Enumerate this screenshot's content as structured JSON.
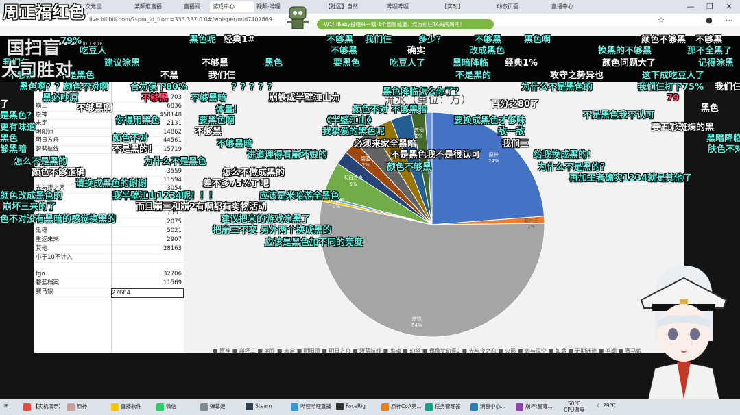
{
  "browser": {
    "tabs": [
      "次元世",
      "某频道直播",
      "直播间",
      "游戏中心",
      "视频-哔哩",
      "【社区】自然",
      "哔哩哔哩",
      "【实时】",
      "动态页面",
      "直播中心"
    ],
    "url": "live.bilibili.com/?spm_id_from=333.337.0.0#/whisper/mid7407869",
    "promo": "-W1川Baby投喂林一瓢-1个圆脑城堡，点击前往TA的房间吧！"
  },
  "stream_info": {
    "bitrate": "4869.22kB",
    "time": "00:13:18"
  },
  "overlay_title": {
    "line1": "周正福红色",
    "line2": "国扫盲",
    "line3": "大司胜对"
  },
  "spreadsheet": {
    "rows": [
      {
        "name": "崩三",
        "value": "6836"
      },
      {
        "name": "原神",
        "value": "458148"
      },
      {
        "name": "未定",
        "value": "2131"
      },
      {
        "name": "阴阳师",
        "value": "14862"
      },
      {
        "name": "明日方舟",
        "value": "44561"
      },
      {
        "name": "碧蓝航线",
        "value": "15719"
      },
      {
        "name": "",
        "value": "3559"
      },
      {
        "name": "",
        "value": "11594"
      },
      {
        "name": "光与夜之恋",
        "value": "3054"
      },
      {
        "name": "",
        "value": "7331"
      },
      {
        "name": "",
        "value": "2075"
      },
      {
        "name": "鬼魂",
        "value": "5021"
      },
      {
        "name": "重返未来",
        "value": "2907"
      },
      {
        "name": "其他",
        "value": "28163"
      },
      {
        "name": "小于10不计入",
        "value": ""
      },
      {
        "name": "fgo",
        "value": "32706"
      },
      {
        "name": "碧蓝档案",
        "value": "11569"
      },
      {
        "name": "赛马娘",
        "value": "27684"
      }
    ],
    "top_value": "703"
  },
  "chart_data": {
    "type": "pie",
    "title": "流水（单位：万）",
    "slices": [
      {
        "label": "原神",
        "pct": 24,
        "color": "#4472c4"
      },
      {
        "label": "崩坏三",
        "pct": 1,
        "color": "#ed7d31"
      },
      {
        "label": "崩铁",
        "pct": 54,
        "color": "#a5a5a5"
      },
      {
        "label": "蔚蓝档案",
        "pct": 0,
        "color": "#ffc000"
      },
      {
        "label": "阴阳师",
        "pct": 0,
        "color": "#5b9bd5"
      },
      {
        "label": "明日方舟",
        "pct": 5,
        "color": "#70ad47"
      },
      {
        "label": "碧蓝",
        "pct": 2,
        "color": "#264478"
      },
      {
        "label": "鬼魂",
        "pct": 2,
        "color": "#9e480e"
      },
      {
        "label": "光与夜",
        "pct": 3,
        "color": "#636363"
      },
      {
        "label": "其他",
        "pct": 3,
        "color": "#997300"
      },
      {
        "label": "fgo",
        "pct": 3,
        "color": "#255e91"
      },
      {
        "label": "赛马娘",
        "pct": 2,
        "color": "#43682b"
      },
      {
        "label": "其他",
        "pct": 1,
        "color": "#698ed0"
      }
    ],
    "shown_labels": [
      {
        "text": "原神",
        "pct": "24%"
      },
      {
        "text": "崩坏三",
        "pct": "1%"
      },
      {
        "text": "崩铁",
        "pct": "54%"
      },
      {
        "text": "明日方舟",
        "pct": "5%"
      },
      {
        "text": "阴阳师",
        "pct": "0%"
      },
      {
        "text": "碧蓝",
        "pct": "2%"
      },
      {
        "text": "其他",
        "pct": "1%"
      }
    ],
    "legend": "■ 原神 ■ 崩坏三 ■ 崩铁 ■ 未定 ■ 阴阳师 ■ 明日方舟 ■ 碧蓝航线 ■ 鬼魂 ■ 幻塔 ■ 偶像梦幻祭2 ■ 光与夜之恋 ■ 火影 ■ 恋与深空 ■ 如鸢 ■ 无期迷途 ■ 鸣潮 ■ 赛马娘"
  },
  "danmaku": [
    {
      "text": "周正福红色",
      "c": "#5ff0e0"
    },
    {
      "text": "不够黑",
      "c": "#5ff0e0"
    },
    {
      "text": "我们仨",
      "c": "#5ff0e0"
    },
    {
      "text": "多少？",
      "c": "#5ff0e0"
    },
    {
      "text": "不够黑",
      "c": "#5ff0e0"
    },
    {
      "text": "黑色啊",
      "c": "#5ff0e0"
    },
    {
      "text": "颜色不够黑",
      "c": "#ffffff"
    },
    {
      "text": "不够黑",
      "c": "#ffffff"
    },
    {
      "text": "79%",
      "c": "#5ff0e0"
    },
    {
      "text": "黑色呢",
      "c": "#5ff0e0"
    },
    {
      "text": "经典1#",
      "c": "#ffffff"
    },
    {
      "text": "吃豆人",
      "c": "#5ff0e0"
    },
    {
      "text": "不够黑",
      "c": "#5ff0e0"
    },
    {
      "text": "确实",
      "c": "#ffffff"
    },
    {
      "text": "改成黑色",
      "c": "#5ff0e0"
    },
    {
      "text": "换黑的不够黑",
      "c": "#5ff0e0"
    },
    {
      "text": "那不全黑了",
      "c": "#5ff0e0"
    },
    {
      "text": "我们仨",
      "c": "#5ff0e0"
    },
    {
      "text": "建议涂黑",
      "c": "#5ff0e0"
    },
    {
      "text": "不够黑",
      "c": "#ffffff"
    },
    {
      "text": "黑色",
      "c": "#5ff0e0"
    },
    {
      "text": "要黑色",
      "c": "#5ff0e0"
    },
    {
      "text": "吃豆人了",
      "c": "#5ff0e0"
    },
    {
      "text": "黑暗降临",
      "c": "#5ff0e0"
    },
    {
      "text": "经典1%",
      "c": "#ffffff"
    },
    {
      "text": "颜色问题大了",
      "c": "#ffffff"
    },
    {
      "text": "记得涂黑",
      "c": "#5ff0e0"
    },
    {
      "text": "不够黑",
      "c": "#5ff0e0"
    },
    {
      "text": "不是黑色",
      "c": "#5ff0e0"
    },
    {
      "text": "不黑",
      "c": "#ffffff"
    },
    {
      "text": "我们仨",
      "c": "#ffffff"
    },
    {
      "text": "不是黑的",
      "c": "#5ff0e0"
    },
    {
      "text": "攻守之势异也",
      "c": "#ffffff"
    },
    {
      "text": "这下成吃豆人了",
      "c": "#5ff0e0"
    },
    {
      "text": "黑色啊？？颜色不对啊",
      "c": "#5ff0e0"
    },
    {
      "text": "合为保下80%",
      "c": "#5ff0e0"
    },
    {
      "text": "？？？？？",
      "c": "#5ff0e0"
    },
    {
      "text": "黑色降临怎么你了？",
      "c": "#5ff0e0"
    },
    {
      "text": "为什么不是黑色的",
      "c": "#5ff0e0"
    },
    {
      "text": "我们仨打下75%",
      "c": "#5ff0e0"
    },
    {
      "text": "我们仨",
      "c": "#ffffff"
    },
    {
      "text": "黑必吵原",
      "c": "#5ff0e0"
    },
    {
      "text": "不够黑",
      "c": "#ff4466"
    },
    {
      "text": "不够黑暗",
      "c": "#5ff0e0"
    },
    {
      "text": "崩铁成半壁江山力",
      "c": "#ffffff"
    },
    {
      "text": "百分之80了",
      "c": "#ffffff"
    },
    {
      "text": "79",
      "c": "#ff4466"
    },
    {
      "text": "了",
      "c": "#ffffff"
    },
    {
      "text": "不够黑啊",
      "c": "#ffffff"
    },
    {
      "text": "体量！",
      "c": "#5ff0e0"
    },
    {
      "text": "颜色不对 不够黑暗",
      "c": "#5ff0e0"
    },
    {
      "text": "不是黑色我不认可",
      "c": "#5ff0e0"
    },
    {
      "text": "黑色",
      "c": "#ffffff"
    },
    {
      "text": "是黑色？",
      "c": "#5ff0e0"
    },
    {
      "text": "你得用黑色",
      "c": "#5ff0e0"
    },
    {
      "text": "要黑色啊",
      "c": "#5ff0e0"
    },
    {
      "text": "《半壁江山》",
      "c": "#5ff0e0"
    },
    {
      "text": "要换成黑色才够味",
      "c": "#5ff0e0"
    },
    {
      "text": "要五彩斑斓的黑",
      "c": "#ffffff"
    },
    {
      "text": "更有味道",
      "c": "#5ff0e0"
    },
    {
      "text": "不够黑",
      "c": "#ffffff"
    },
    {
      "text": "我挚爱的黑色呢",
      "c": "#5ff0e0"
    },
    {
      "text": "敌一敌",
      "c": "#5ff0e0"
    },
    {
      "text": "黑色",
      "c": "#5ff0e0"
    },
    {
      "text": "颜色不对",
      "c": "#5ff0e0"
    },
    {
      "text": "必须来家全黑暗",
      "c": "#ffffff"
    },
    {
      "text": "黑暗降临",
      "c": "#5ff0e0"
    },
    {
      "text": "够黑暗",
      "c": "#5ff0e0"
    },
    {
      "text": "不够黑暗",
      "c": "#5ff0e0"
    },
    {
      "text": "我们三",
      "c": "#ffffff"
    },
    {
      "text": "肤色不对",
      "c": "#5ff0e0"
    },
    {
      "text": "不是黑的！",
      "c": "#ffffff"
    },
    {
      "text": "讲道理得看崩坏娘的",
      "c": "#5ff0e0"
    },
    {
      "text": "不是黑色我不是很认可",
      "c": "#ffffff"
    },
    {
      "text": "给我换成黑的！",
      "c": "#5ff0e0"
    },
    {
      "text": "怎么不是黑的",
      "c": "#5ff0e0"
    },
    {
      "text": "为什么不是黑色",
      "c": "#5ff0e0"
    },
    {
      "text": "颜色不够黑",
      "c": "#5ff0e0"
    },
    {
      "text": "怎么不做成黑的",
      "c": "#ffffff"
    },
    {
      "text": "为什么不是黑的？",
      "c": "#5ff0e0"
    },
    {
      "text": "颜色不够正确",
      "c": "#ffffff"
    },
    {
      "text": "再加王者确实1234就是其他了",
      "c": "#5ff0e0"
    },
    {
      "text": "请换成黑色的谢谢",
      "c": "#5ff0e0"
    },
    {
      "text": "差不多75%了吧",
      "c": "#ffffff"
    },
    {
      "text": "颜色改成黑色的",
      "c": "#5ff0e0"
    },
    {
      "text": "我半壁江山1234呢！！！",
      "c": "#5ff0e0"
    },
    {
      "text": "应该是米哈游全黑色",
      "c": "#5ff0e0"
    },
    {
      "text": "崩坏三来的了",
      "c": "#5ff0e0"
    },
    {
      "text": "而且崩三和崩2有啊都有实物活动",
      "c": "#ffffff"
    },
    {
      "text": "色不对没有黑暗的感觉换黑的",
      "c": "#5ff0e0"
    },
    {
      "text": "建议把米的游戏涂黑了",
      "c": "#5ff0e0"
    },
    {
      "text": "把崩三不变 另外两个换成黑的",
      "c": "#5ff0e0"
    },
    {
      "text": "应该是黑色加不同的亮度",
      "c": "#5ff0e0"
    }
  ],
  "taskbar": {
    "items": [
      "【实机演示】",
      "原神",
      "直播软件",
      "微信",
      "弹幕姬",
      "Steam",
      "哔哩哔哩直播",
      "FaceRig",
      "原神CoA第...",
      "任务管理器",
      "消息中心...",
      "崩坏:星穹..."
    ],
    "temp": "50°C",
    "cpu_label": "CPU温度",
    "weather": "29°C"
  }
}
